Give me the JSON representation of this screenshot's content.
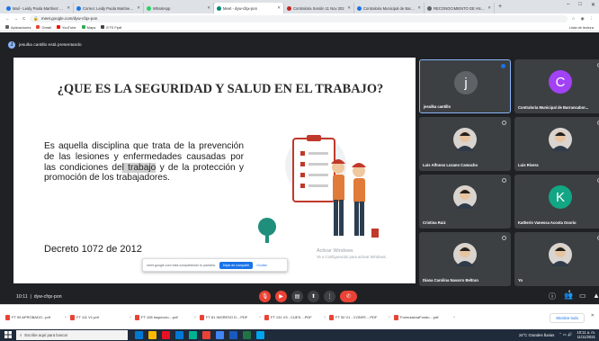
{
  "browser": {
    "tabs": [
      {
        "title": "Mail - Leidy Paola Martínez Bar",
        "favicon": "#1a73e8",
        "active": false
      },
      {
        "title": "Correo: Leidy Paola Martínez B",
        "favicon": "#1a73e8",
        "active": false
      },
      {
        "title": "WhatsApp",
        "favicon": "#25d366",
        "active": false
      },
      {
        "title": "Meet - dyw-cfqx-pon",
        "favicon": "#00897b",
        "active": true
      },
      {
        "title": "Contraloria Sesión 11 Nov 202",
        "favicon": "#c5221f",
        "active": false
      },
      {
        "title": "Contraloria Municipal de Barran",
        "favicon": "#1a73e8",
        "active": false
      },
      {
        "title": "RECONOCIMIENTO DE ANTEC",
        "favicon": "#5f6368",
        "active": false
      }
    ],
    "new_tab": "+",
    "window_controls": [
      "–",
      "□",
      "✕"
    ],
    "nav": [
      "←",
      "→",
      "C"
    ],
    "lock": "🔒",
    "url": "meet.google.com/dyw-cfqx-pon",
    "right_icons": [
      "☆",
      "◉",
      "⋮"
    ]
  },
  "bookmarks": {
    "items": [
      {
        "label": "Aplicaciones",
        "color": "#5f6368"
      },
      {
        "label": "Gmail",
        "color": "#ea4335"
      },
      {
        "label": "YouTube",
        "color": "#ff0000"
      },
      {
        "label": "Maps",
        "color": "#34a853"
      },
      {
        "label": "ETS Fpdf",
        "color": "#444"
      }
    ],
    "reading_list": "Lista de lectura"
  },
  "meet": {
    "presenter_initial": "J",
    "presenter_text": "jesulka cantillo está presentando",
    "slide": {
      "title": "¿QUE ES LA SEGURIDAD Y SALUD EN EL TRABAJO?",
      "body_before": "Es aquella disciplina que trata de la prevención de las lesiones y enfermedades causadas por las condiciones de",
      "body_highlight": "l trabajo",
      "body_after": " y de la protección y promoción de los trabajadores.",
      "footer": "Decreto 1072 de 2012"
    },
    "watermark": {
      "line1": "Activar Windows",
      "line2": "Ve a Configuración para activar Windows."
    },
    "share_bar": {
      "text": "meet.google.com está compartiendo tu pantalla.",
      "stop": "Dejar de compartir",
      "hide": "Ocultar"
    },
    "participants": [
      {
        "name": "jesulka cantillo",
        "initial": "j",
        "avatar_color": "#5f6368",
        "type": "letter"
      },
      {
        "name": "Contraloria Municipal de Barrancabor...",
        "initial": "C",
        "avatar_color": "#a142f4",
        "type": "letter"
      },
      {
        "name": "Luis Alfonso Lozano Camacho",
        "initial": "",
        "avatar_color": "#8a6a55",
        "type": "photo"
      },
      {
        "name": "Luis Rivera",
        "initial": "",
        "avatar_color": "#b07060",
        "type": "photo"
      },
      {
        "name": "Cristina Ruiz",
        "initial": "",
        "avatar_color": "#6f5a4a",
        "type": "photo"
      },
      {
        "name": "Katherin Vanessa Acosta Osorio",
        "initial": "K",
        "avatar_color": "#12a684",
        "type": "letter"
      },
      {
        "name": "Diana Carolina Navarro Beltran",
        "initial": "",
        "avatar_color": "#c89070",
        "type": "photo"
      },
      {
        "name": "Yo",
        "initial": "",
        "avatar_color": "#9a7055",
        "type": "photo"
      }
    ],
    "controls": {
      "time": "10:11",
      "meeting_code": "dyw-cfqx-pon",
      "buttons": [
        {
          "icon": "mic-off-icon",
          "glyph": "🎙",
          "color": "#ea4335"
        },
        {
          "icon": "camera-off-icon",
          "glyph": "▶",
          "color": "#ea4335"
        },
        {
          "icon": "captions-icon",
          "glyph": "▤",
          "color": "#3c4043"
        },
        {
          "icon": "present-icon",
          "glyph": "⬆",
          "color": "#3c4043"
        },
        {
          "icon": "more-icon",
          "glyph": "⋮",
          "color": "#3c4043"
        },
        {
          "icon": "end-call-icon",
          "glyph": "✆",
          "color": "#ea4335"
        }
      ],
      "right": [
        {
          "icon": "info-icon",
          "glyph": "ⓘ"
        },
        {
          "icon": "people-icon",
          "glyph": "👥"
        },
        {
          "icon": "chat-icon",
          "glyph": "▭"
        },
        {
          "icon": "activities-icon",
          "glyph": "▲"
        }
      ],
      "people_count": "8"
    }
  },
  "downloads": {
    "items": [
      "FT 99 APROBADO...pdf",
      "FT 111 V1.pdf",
      "FT 108 Inspeccio....pdf",
      "FT 81 INGRESO D....PDF",
      "FT 131 V3 - CUES....PDF",
      "FT 00 V1 - CONFE....PDF",
      "FormulaxnaFondo....pdf"
    ],
    "show_all": "Mostrar todo",
    "close": "✕"
  },
  "taskbar": {
    "search_placeholder": "Escribe aquí para buscar",
    "apps": [
      "#0078d4",
      "#ffb900",
      "#e81123",
      "#0078d4",
      "#00b294",
      "#ea4335",
      "#4285f4",
      "#185abd",
      "#217346",
      "#00a4ef"
    ],
    "weather": "24°C Grandes lluvias",
    "time": "10:11 a. m.",
    "date": "11/11/2021"
  }
}
